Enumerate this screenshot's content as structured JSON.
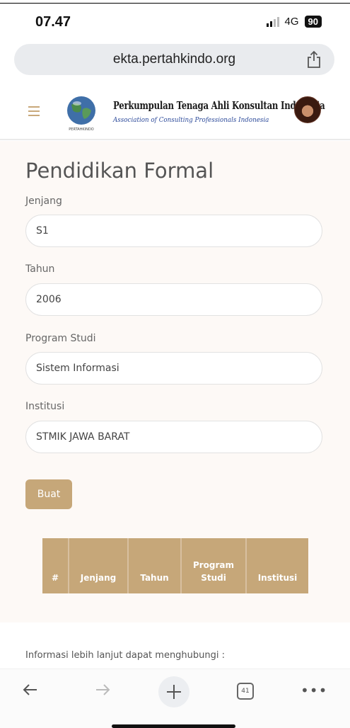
{
  "status_bar": {
    "time": "07.47",
    "network": "4G",
    "battery": "90"
  },
  "browser": {
    "url": "ekta.pertahkindo.org",
    "tab_count": "41"
  },
  "header": {
    "org_name": "Perkumpulan Tenaga Ahli Konsultan Indonesia",
    "org_subtitle": "Association of Consulting Professionals Indonesia",
    "logo_caption": "PERTAHKINDO"
  },
  "form": {
    "title": "Pendidikan Formal",
    "fields": [
      {
        "label": "Jenjang",
        "value": "S1"
      },
      {
        "label": "Tahun",
        "value": "2006"
      },
      {
        "label": "Program Studi",
        "value": "Sistem Informasi"
      },
      {
        "label": "Institusi",
        "value": "STMIK JAWA BARAT"
      }
    ],
    "submit_label": "Buat"
  },
  "table": {
    "headers": [
      "#",
      "Jenjang",
      "Tahun",
      "Program Studi",
      "Institusi"
    ]
  },
  "footer": {
    "info_text": "Informasi lebih lanjut dapat menghubungi :"
  },
  "colors": {
    "accent": "#c6a779",
    "panel_bg": "#fdf9f6"
  }
}
